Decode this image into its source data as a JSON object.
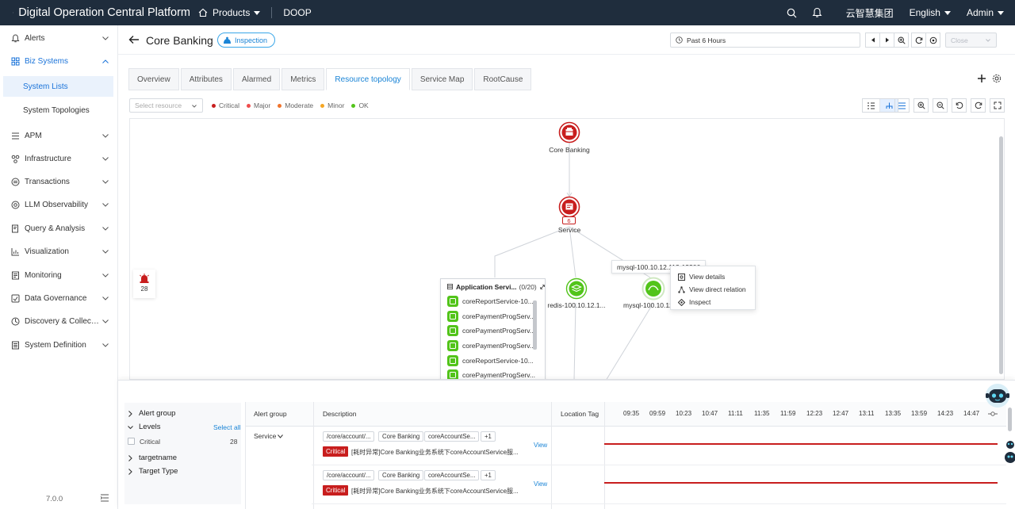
{
  "app": {
    "title": "Digital Operation Central Platform",
    "products_label": "Products",
    "doop_label": "DOOP",
    "org_label": "云智慧集团",
    "language_label": "English",
    "user_label": "Admin"
  },
  "sidebar": {
    "items": [
      {
        "label": "Alerts",
        "icon": "bell-icon"
      },
      {
        "label": "Biz Systems",
        "icon": "grid-icon"
      },
      {
        "label": "APM",
        "icon": "list-icon"
      },
      {
        "label": "Infrastructure",
        "icon": "nodes-icon"
      },
      {
        "label": "Transactions",
        "icon": "exchange-icon"
      },
      {
        "label": "LLM Observability",
        "icon": "target-icon"
      },
      {
        "label": "Query & Analysis",
        "icon": "search-doc-icon"
      },
      {
        "label": "Visualization",
        "icon": "chart-icon"
      },
      {
        "label": "Monitoring",
        "icon": "monitor-icon"
      },
      {
        "label": "Data Governance",
        "icon": "database-icon"
      },
      {
        "label": "Discovery & Collection",
        "icon": "discovery-icon"
      },
      {
        "label": "System Definition",
        "icon": "settings-doc-icon"
      }
    ],
    "sub_items": [
      {
        "label": "System Lists",
        "active": true
      },
      {
        "label": "System Topologies",
        "active": false
      }
    ],
    "version": "7.0.0"
  },
  "header": {
    "title": "Core Banking",
    "inspection_label": "Inspection",
    "time_range": "Past 6 Hours",
    "close_placeholder": "Close"
  },
  "tabs": [
    {
      "label": "Overview"
    },
    {
      "label": "Attributes"
    },
    {
      "label": "Alarmed"
    },
    {
      "label": "Metrics"
    },
    {
      "label": "Resource topology",
      "active": true
    },
    {
      "label": "Service Map"
    },
    {
      "label": "RootCause"
    }
  ],
  "filter": {
    "select_placeholder": "Select resource",
    "legend": [
      {
        "label": "Critical",
        "color": "#c81e1e"
      },
      {
        "label": "Major",
        "color": "#ef4d4d"
      },
      {
        "label": "Moderate",
        "color": "#f0742c"
      },
      {
        "label": "Minor",
        "color": "#f5a623"
      },
      {
        "label": "OK",
        "color": "#52c41a"
      }
    ]
  },
  "topology": {
    "root": {
      "label": "Core Banking",
      "status": "critical"
    },
    "service": {
      "label": "Service",
      "count": "6",
      "status": "critical"
    },
    "app_box": {
      "title": "Application Servi...",
      "count": "(0/20)",
      "items": [
        "coreReportService-10...",
        "corePaymentProgServ...",
        "corePaymentProgServ...",
        "corePaymentProgServ...",
        "coreReportService-10...",
        "corePaymentProgServ..."
      ]
    },
    "redis": {
      "label": "redis-100.10.12.1...",
      "status": "ok"
    },
    "mysql": {
      "label": "mysql-100.10.12...",
      "status": "ok"
    },
    "tooltip": "mysql-100.10.12.113-13306",
    "context_menu": [
      {
        "label": "View details",
        "icon": "details-icon"
      },
      {
        "label": "View direct relation",
        "icon": "relation-icon"
      },
      {
        "label": "Inspect",
        "icon": "inspect-icon"
      }
    ],
    "alarm_count": "28"
  },
  "alerts": {
    "filter_groups": {
      "alert_group": "Alert group",
      "levels": "Levels",
      "select_all": "Select all",
      "critical_label": "Critical",
      "critical_count": "28",
      "targetname": "targetname",
      "target_type": "Target Type"
    },
    "columns": {
      "alert_group": "Alert group",
      "description": "Description",
      "location_tag": "Location Tag"
    },
    "times": [
      "09:35",
      "09:59",
      "10:23",
      "10:47",
      "11:11",
      "11:35",
      "11:59",
      "12:23",
      "12:47",
      "13:11",
      "13:35",
      "13:59",
      "14:23",
      "14:47"
    ],
    "group_label": "Service",
    "rows": [
      {
        "tags": [
          "/core/account/...",
          "Core Banking",
          "coreAccountSe...",
          "+1"
        ],
        "severity": "Critical",
        "description": "[耗时异常]Core Banking业务系统下coreAccountService服...",
        "action": "View"
      },
      {
        "tags": [
          "/core/account/...",
          "Core Banking",
          "coreAccountSe...",
          "+1"
        ],
        "severity": "Critical",
        "description": "[耗时异常]Core Banking业务系统下coreAccountService服...",
        "action": "View"
      }
    ]
  }
}
